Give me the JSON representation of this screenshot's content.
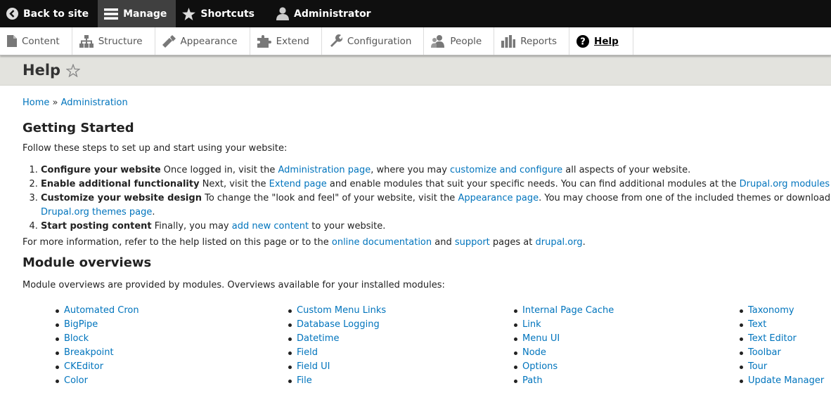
{
  "toolbar": {
    "back": "Back to site",
    "manage": "Manage",
    "shortcuts": "Shortcuts",
    "user": "Administrator"
  },
  "tray": {
    "content": "Content",
    "structure": "Structure",
    "appearance": "Appearance",
    "extend": "Extend",
    "configuration": "Configuration",
    "people": "People",
    "reports": "Reports",
    "help": "Help"
  },
  "page": {
    "title": "Help"
  },
  "breadcrumb": {
    "home": "Home",
    "sep": " » ",
    "admin": "Administration"
  },
  "getting_started": {
    "heading": "Getting Started",
    "intro": "Follow these steps to set up and start using your website:",
    "step1": {
      "bold": "Configure your website",
      "t1": " Once logged in, visit the ",
      "l1": "Administration page",
      "t2": ", where you may ",
      "l2": "customize and configure",
      "t3": " all aspects of your website."
    },
    "step2": {
      "bold": "Enable additional functionality",
      "t1": " Next, visit the ",
      "l1": "Extend page",
      "t2": " and enable modules that suit your specific needs. You can find additional modules at the ",
      "l2": "Drupal.org modules page",
      "t3": "."
    },
    "step3": {
      "bold": "Customize your website design",
      "t1": " To change the \"look and feel\" of your website, visit the ",
      "l1": "Appearance page",
      "t2": ". You may choose from one of the included themes or download additio",
      "l2": "Drupal.org themes page",
      "t3": "."
    },
    "step4": {
      "bold": "Start posting content",
      "t1": " Finally, you may ",
      "l1": "add new content",
      "t2": " to your website."
    },
    "more": {
      "t1": "For more information, refer to the help listed on this page or to the ",
      "l1": "online documentation",
      "t2": " and ",
      "l2": "support",
      "t3": " pages at ",
      "l3": "drupal.org",
      "t4": "."
    }
  },
  "modules": {
    "heading": "Module overviews",
    "intro": "Module overviews are provided by modules. Overviews available for your installed modules:",
    "col1": [
      "Automated Cron",
      "BigPipe",
      "Block",
      "Breakpoint",
      "CKEditor",
      "Color"
    ],
    "col2": [
      "Custom Menu Links",
      "Database Logging",
      "Datetime",
      "Field",
      "Field UI",
      "File"
    ],
    "col3": [
      "Internal Page Cache",
      "Link",
      "Menu UI",
      "Node",
      "Options",
      "Path"
    ],
    "col4": [
      "Taxonomy",
      "Text",
      "Text Editor",
      "Toolbar",
      "Tour",
      "Update Manager"
    ]
  }
}
